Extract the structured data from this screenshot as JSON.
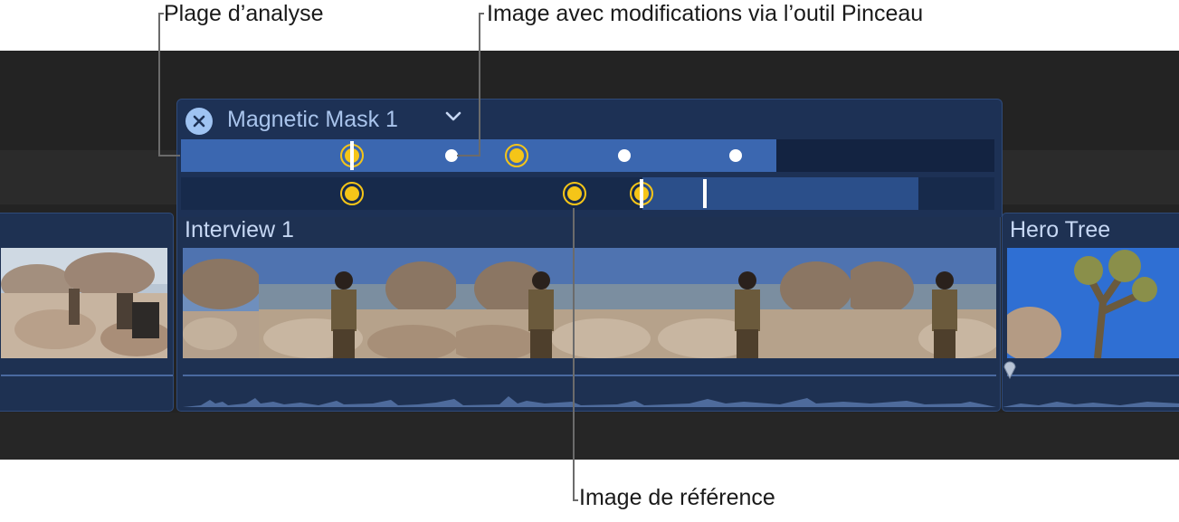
{
  "callouts": {
    "analysis_range": "Plage d’analyse",
    "brush_frame": "Image avec modifications via l’outil Pinceau",
    "reference_frame": "Image de référence"
  },
  "mask": {
    "title": "Magnetic Mask 1",
    "close_icon": "close-x-icon",
    "menu_icon": "chevron-down-icon"
  },
  "clips": {
    "main": {
      "title": "Interview 1"
    },
    "next": {
      "title": "Hero Tree"
    }
  },
  "colors": {
    "timeline_bg": "#232323",
    "clip_bg": "#1e3152",
    "analysis_range": "#3b67b0",
    "reference_keyframe": "#f5c518",
    "brush_keyframe": "#ffffff"
  }
}
